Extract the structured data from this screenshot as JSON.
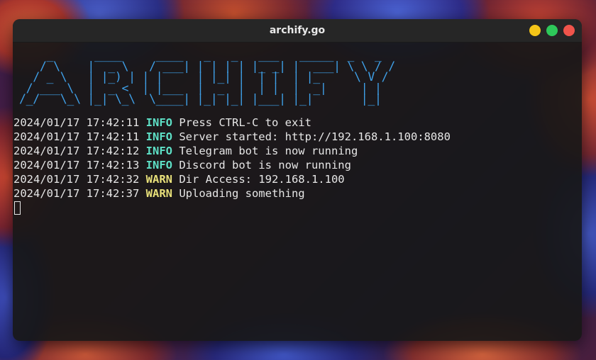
{
  "window": {
    "title": "archify.go"
  },
  "terminal": {
    "banner": "    _      ____     ____   _   _   ___   _____  _   _ \n   / \\    |  _ \\   / ___| | | | | |_ _| |  ___| \\ \\ / /\n  / _ \\   | |_) | | |     | |_| |  | |  | |_     \\ V / \n / ___ \\  |  _ <  | |___  |  _  |  | |  |  _|     | |  \n/_/   \\_\\ |_| \\_\\  \\____| |_| |_| |___| |_|       |_|  ",
    "logs": [
      {
        "timestamp": "2024/01/17 17:42:11",
        "level": "INFO",
        "message": "Press CTRL-C to exit"
      },
      {
        "timestamp": "2024/01/17 17:42:11",
        "level": "INFO",
        "message": "Server started: http://192.168.1.100:8080"
      },
      {
        "timestamp": "2024/01/17 17:42:12",
        "level": "INFO",
        "message": "Telegram bot is now running"
      },
      {
        "timestamp": "2024/01/17 17:42:13",
        "level": "INFO",
        "message": "Discord bot is now running"
      },
      {
        "timestamp": "2024/01/17 17:42:32",
        "level": "WARN",
        "message": "Dir Access: 192.168.1.100"
      },
      {
        "timestamp": "2024/01/17 17:42:37",
        "level": "WARN",
        "message": "Uploading something"
      }
    ]
  },
  "colors": {
    "banner": "#3fa0e8",
    "info": "#5ee0c6",
    "warn": "#e8e07a",
    "text": "#e6e6e6",
    "minimize": "#f5c518",
    "maximize": "#2ec95a",
    "close": "#f0544b"
  }
}
